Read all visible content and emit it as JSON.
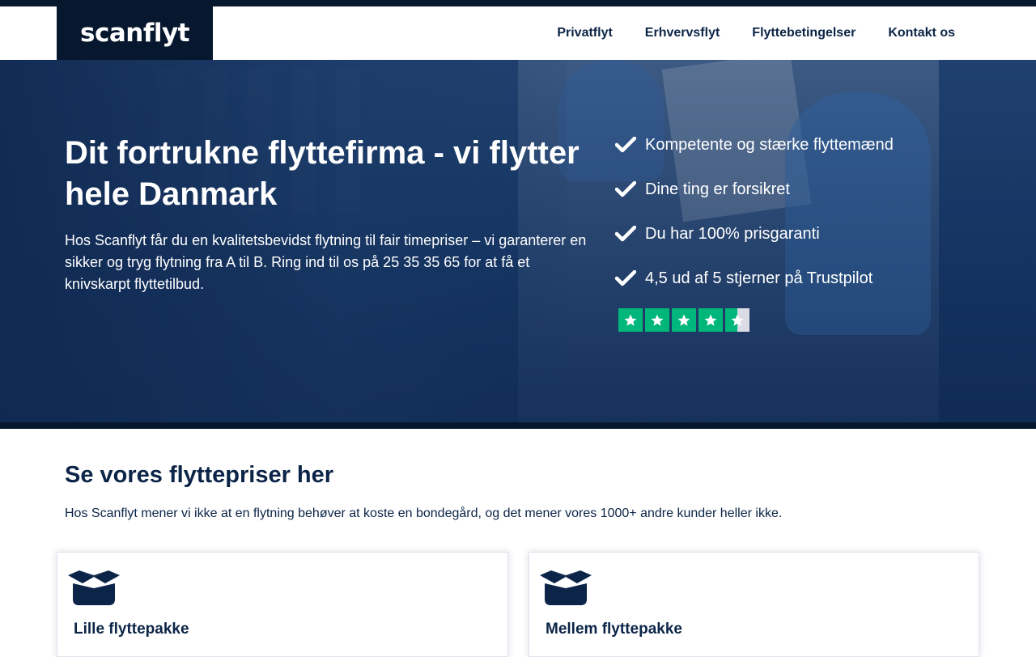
{
  "brand": {
    "logo_text": "scanflyt"
  },
  "nav": {
    "items": [
      {
        "label": "Privatflyt"
      },
      {
        "label": "Erhvervsflyt"
      },
      {
        "label": "Flyttebetingelser"
      },
      {
        "label": "Kontakt os"
      }
    ]
  },
  "hero": {
    "title": "Dit fortrukne flyttefirma - vi flytter hele Danmark",
    "text": "Hos Scanflyt får du en kvalitetsbevidst flytning til fair timepriser – vi garanterer en sikker og tryg flytning fra A til B. Ring ind til os på 25 35 35 65 for at få et knivskarpt flyttetilbud.",
    "benefits": [
      {
        "label": "Kompetente og stærke flyttemænd"
      },
      {
        "label": "Dine ting er forsikret"
      },
      {
        "label": "Du har 100% prisgaranti"
      },
      {
        "label": "4,5 ud af 5 stjerner på Trustpilot"
      }
    ],
    "rating": {
      "value": 4.5,
      "max": 5,
      "icon": "trustpilot-star-icon",
      "color": "#00b67a"
    }
  },
  "prices": {
    "title": "Se vores flyttepriser her",
    "subtitle": "Hos Scanflyt mener vi ikke at en flytning behøver at koste en bondegård, og det mener vores 1000+ andre kunder heller ikke.",
    "cards": [
      {
        "title": "Lille flyttepakke",
        "icon": "open-box-icon"
      },
      {
        "title": "Mellem flyttepakke",
        "icon": "open-box-icon"
      }
    ]
  },
  "colors": {
    "navy": "#07172e",
    "text": "#0b2447",
    "trustpilot": "#00b67a"
  }
}
